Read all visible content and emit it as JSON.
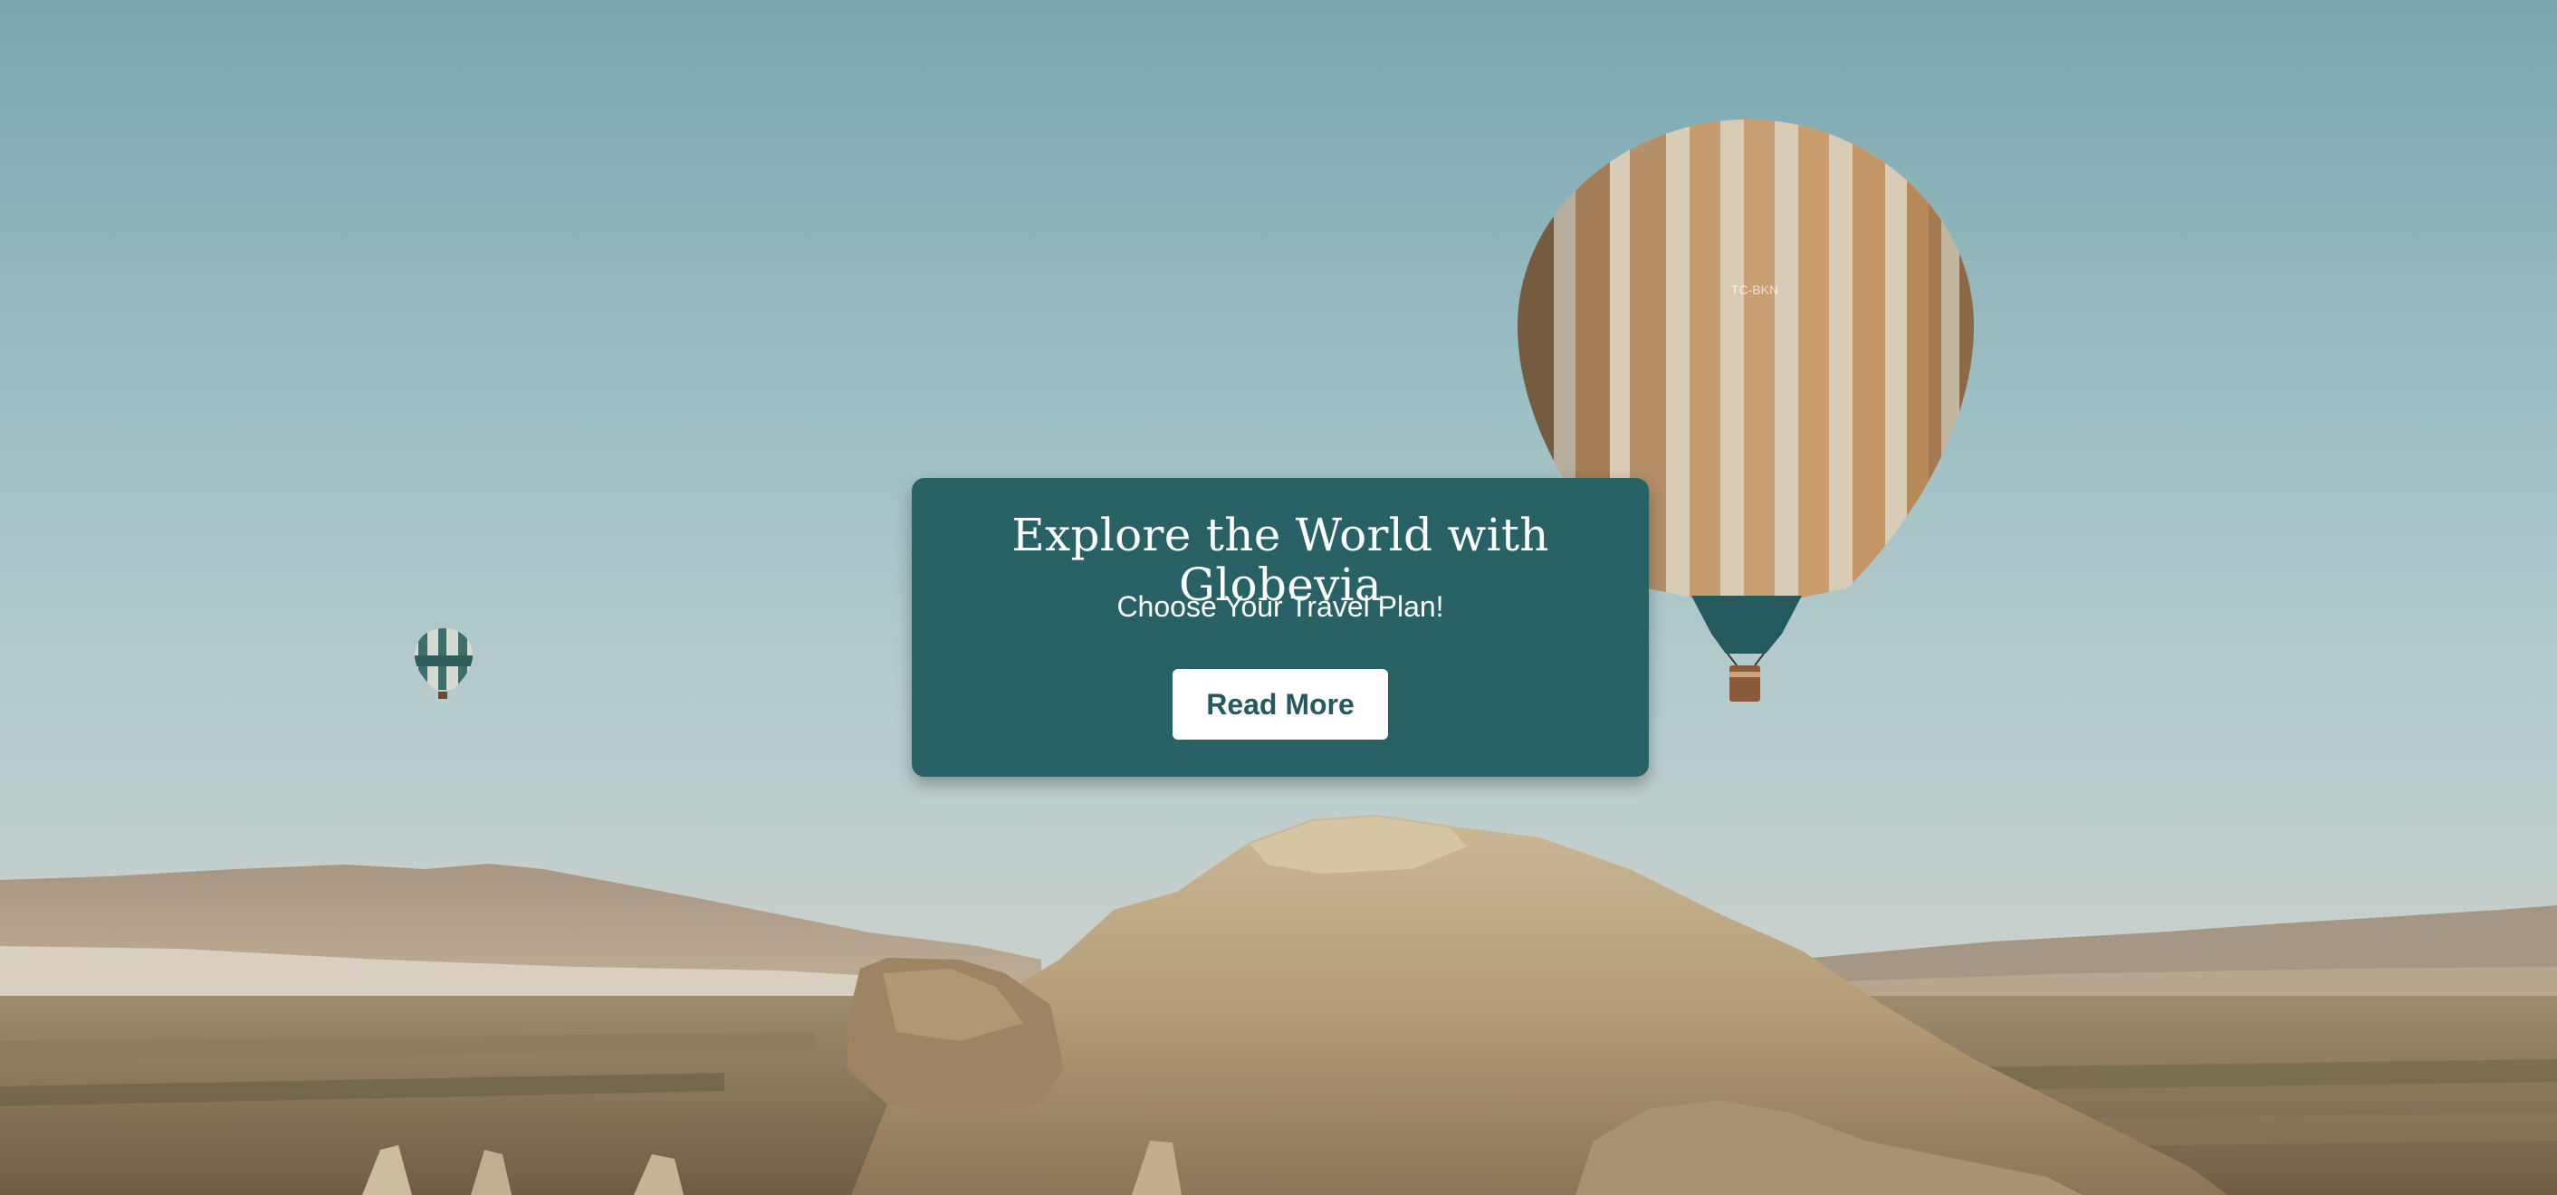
{
  "hero": {
    "title": "Explore the World with Globevia",
    "subtitle": "Choose Your Travel Plan!",
    "cta_label": "Read More",
    "balloon_registration": "TC-BKN"
  },
  "colors": {
    "card_background": "#286266",
    "button_background": "#ffffff",
    "button_text": "#245a5e",
    "sky_top": "#7fa8b0",
    "sky_bottom": "#c9d4d4",
    "terrain": "#b8a282"
  }
}
